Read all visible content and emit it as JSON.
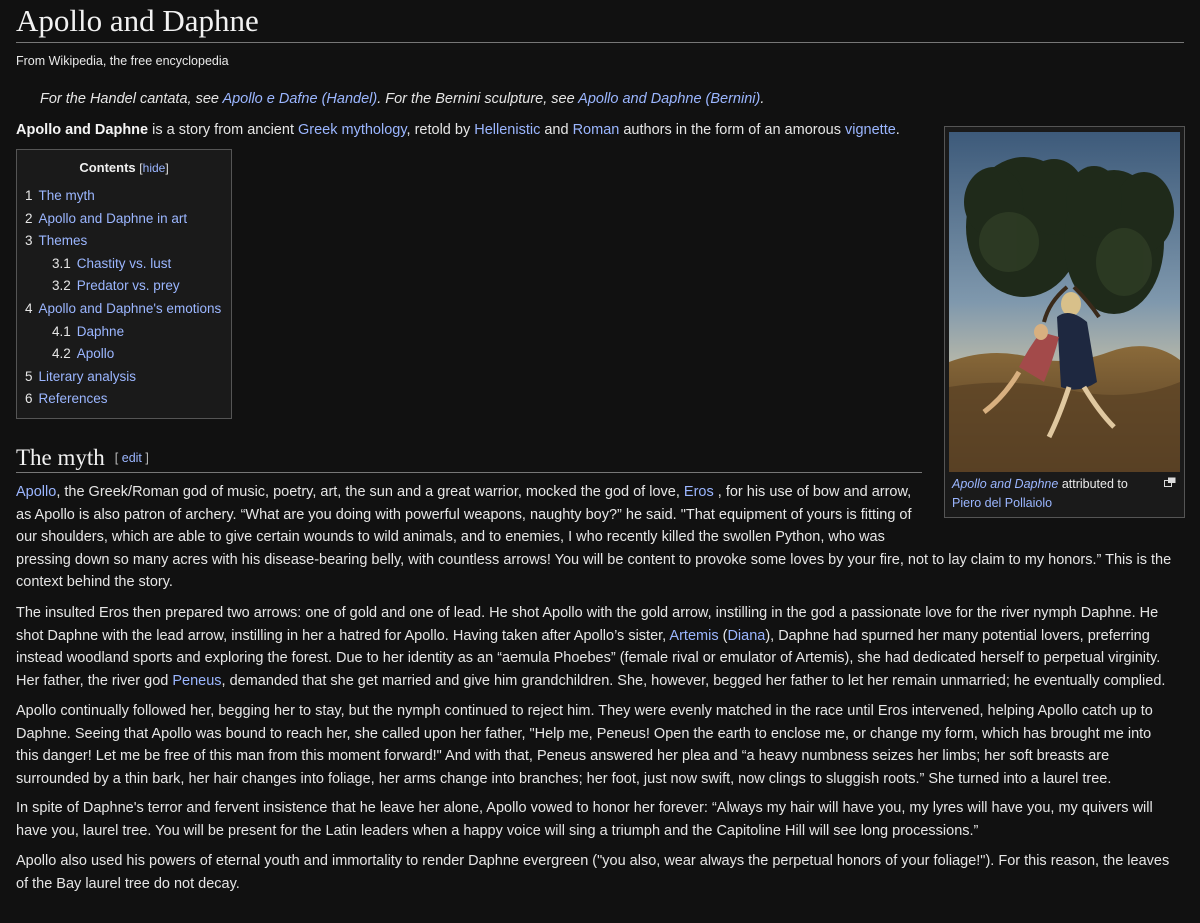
{
  "title": "Apollo and Daphne",
  "tagline": "From Wikipedia, the free encyclopedia",
  "hatnote": {
    "part1": "For the Handel cantata, see ",
    "link1": "Apollo e Dafne (Handel)",
    "part2": ". For the Bernini sculpture, see ",
    "link2": "Apollo and Daphne (Bernini)",
    "part3": "."
  },
  "lead": {
    "bold": "Apollo and Daphne",
    "t1": " is a story from ancient ",
    "l1": "Greek mythology",
    "t2": ", retold by ",
    "l2": "Hellenistic",
    "t3": " and ",
    "l3": "Roman",
    "t4": " authors in the form of an amorous ",
    "l4": "vignette",
    "t5": "."
  },
  "toc": {
    "title": "Contents",
    "hide_open": "[",
    "hide_label": "hide",
    "hide_close": "]",
    "items": [
      {
        "num": "1",
        "label": "The myth"
      },
      {
        "num": "2",
        "label": "Apollo and Daphne in art"
      },
      {
        "num": "3",
        "label": "Themes"
      },
      {
        "num": "3.1",
        "label": "Chastity vs. lust"
      },
      {
        "num": "3.2",
        "label": "Predator vs. prey"
      },
      {
        "num": "4",
        "label": "Apollo and Daphne's emotions"
      },
      {
        "num": "4.1",
        "label": "Daphne"
      },
      {
        "num": "4.2",
        "label": "Apollo"
      },
      {
        "num": "5",
        "label": "Literary analysis"
      },
      {
        "num": "6",
        "label": "References"
      }
    ]
  },
  "infobox": {
    "caption_link": "Apollo and Daphne",
    "caption_text": " attributed to",
    "caption_link2": "Piero del Pollaiolo"
  },
  "section": {
    "heading": "The myth",
    "edit_open": "[ ",
    "edit_label": "edit",
    "edit_close": " ]"
  },
  "p1": {
    "l1": "Apollo",
    "a": ", the Greek/Roman god of music, poetry, art, the sun and a great warrior, mocked the god of love, ",
    "l2": "Eros",
    "b": " , for his use of bow and arrow,",
    "line2": "as Apollo is also patron of archery. “What are you doing with powerful weapons, naughty boy?” he said. \"That equipment of yours is fitting of",
    "line3": "our shoulders, which are able to give certain wounds to wild animals, and to enemies, I who recently killed the swollen Python, who was",
    "line4": "pressing down so many acres with his disease-bearing belly, with countless arrows! You will be content to provoke some loves by your fire, not to lay claim to my honors.” This is the",
    "line5": "context behind the story."
  },
  "p2": {
    "line1": "The insulted Eros then prepared two arrows: one of gold and one of lead. He shot Apollo with the gold arrow, instilling in the god a passionate love for the river nymph Daphne. He",
    "line2a": "shot Daphne with the lead arrow, instilling in her a hatred for Apollo. Having taken after Apollo’s sister, ",
    "l1": "Artemis",
    "paren_open": " (",
    "l2": "Diana",
    "line2b": "), Daphne had spurned her many potential lovers, preferring",
    "line3": "instead woodland sports and exploring the forest. Due to her identity as an “aemula Phoebes” (female rival or emulator of Artemis), she had dedicated herself to perpetual virginity.",
    "line4a": "Her father, the river god ",
    "l3": "Peneus",
    "line4b": ", demanded that she get married and give him grandchildren. She, however, begged her father to let her remain unmarried; he eventually complied."
  },
  "p3": {
    "line1": "Apollo continually followed her, begging her to stay, but the nymph continued to reject him. They were evenly matched in the race until Eros intervened, helping Apollo catch up to",
    "line2": "Daphne. Seeing that Apollo was bound to reach her, she called upon her father, \"Help me, Peneus! Open the earth to enclose me, or change my form, which has brought me into",
    "line3": "this danger! Let me be free of this man from this moment forward!\" And with that, Peneus answered her plea and “a heavy numbness seizes her limbs; her soft breasts are",
    "line4": "surrounded by a thin bark, her hair changes into foliage, her arms change into branches; her foot, just now swift, now clings to sluggish roots.” She turned into a laurel tree."
  },
  "p4": {
    "line1": "In spite of Daphne's terror and fervent insistence that he leave her alone, Apollo vowed to honor her forever: “Always my hair will have you, my lyres will have you, my quivers will",
    "line2": "have you, laurel tree. You will be present for the Latin leaders when a happy voice will sing a triumph and the Capitoline Hill will see long processions.”"
  },
  "p5": {
    "line1": "Apollo also used his powers of eternal youth and immortality to render Daphne evergreen (\"you also, wear always the perpetual honors of your foliage!\"). For this reason, the leaves",
    "line2": "of the Bay laurel tree do not decay."
  },
  "colors": {
    "background": "#111111",
    "text": "#e6e6e6",
    "link": "#9bb6ff",
    "border": "#555555"
  },
  "icons": {
    "enlarge": "enlarge-icon"
  }
}
